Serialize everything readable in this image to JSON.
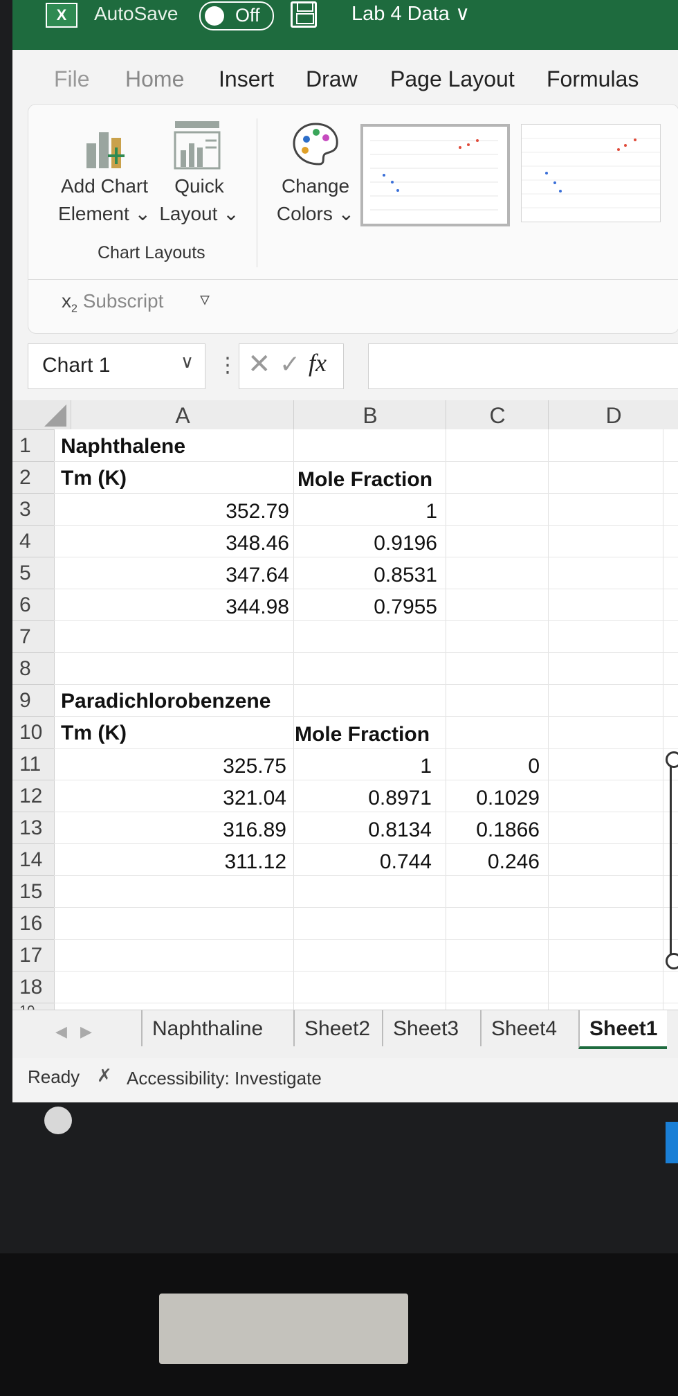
{
  "titlebar": {
    "autosave_label": "AutoSave",
    "autosave_state": "Off",
    "document_title": "Lab 4 Data ∨"
  },
  "ribbon_tabs": [
    "File",
    "Home",
    "Insert",
    "Draw",
    "Page Layout",
    "Formulas"
  ],
  "ribbon": {
    "add_chart_element": [
      "Add Chart",
      "Element ⌄"
    ],
    "quick_layout": [
      "Quick",
      "Layout ⌄"
    ],
    "change_colors": [
      "Change",
      "Colors ⌄"
    ],
    "group_label": "Chart Layouts",
    "subscript_label": "Subscript"
  },
  "formula_bar": {
    "name_box": "Chart 1",
    "fx": "fx"
  },
  "columns": [
    "A",
    "B",
    "C",
    "D"
  ],
  "rows": [
    "1",
    "2",
    "3",
    "4",
    "5",
    "6",
    "7",
    "8",
    "9",
    "10",
    "11",
    "12",
    "13",
    "14",
    "15",
    "16",
    "17",
    "18",
    "10"
  ],
  "cells": {
    "A1": "Naphthalene",
    "A2": "Tm (K)",
    "B2": "Mole Fraction",
    "A3": "352.79",
    "B3": "1",
    "A4": "348.46",
    "B4": "0.9196",
    "A5": "347.64",
    "B5": "0.8531",
    "A6": "344.98",
    "B6": "0.7955",
    "A9": "Paradichlorobenzene",
    "A10": "Tm (K)",
    "B10": "Mole Fraction",
    "A11": "325.75",
    "B11": "1",
    "C11": "0",
    "A12": "321.04",
    "B12": "0.8971",
    "C12": "0.1029",
    "A13": "316.89",
    "B13": "0.8134",
    "C13": "0.1866",
    "A14": "311.12",
    "B14": "0.744",
    "C14": "0.246"
  },
  "sheet_tabs": [
    "Naphthaline",
    "Sheet2",
    "Sheet3",
    "Sheet4",
    "Sheet1"
  ],
  "active_sheet": "Sheet1",
  "status": {
    "ready": "Ready",
    "accessibility": "Accessibility: Investigate"
  },
  "colors": {
    "excel_green": "#1e6b3e",
    "accent_blue_marker": "#3a6fd8",
    "accent_red_marker": "#e04b3a"
  }
}
